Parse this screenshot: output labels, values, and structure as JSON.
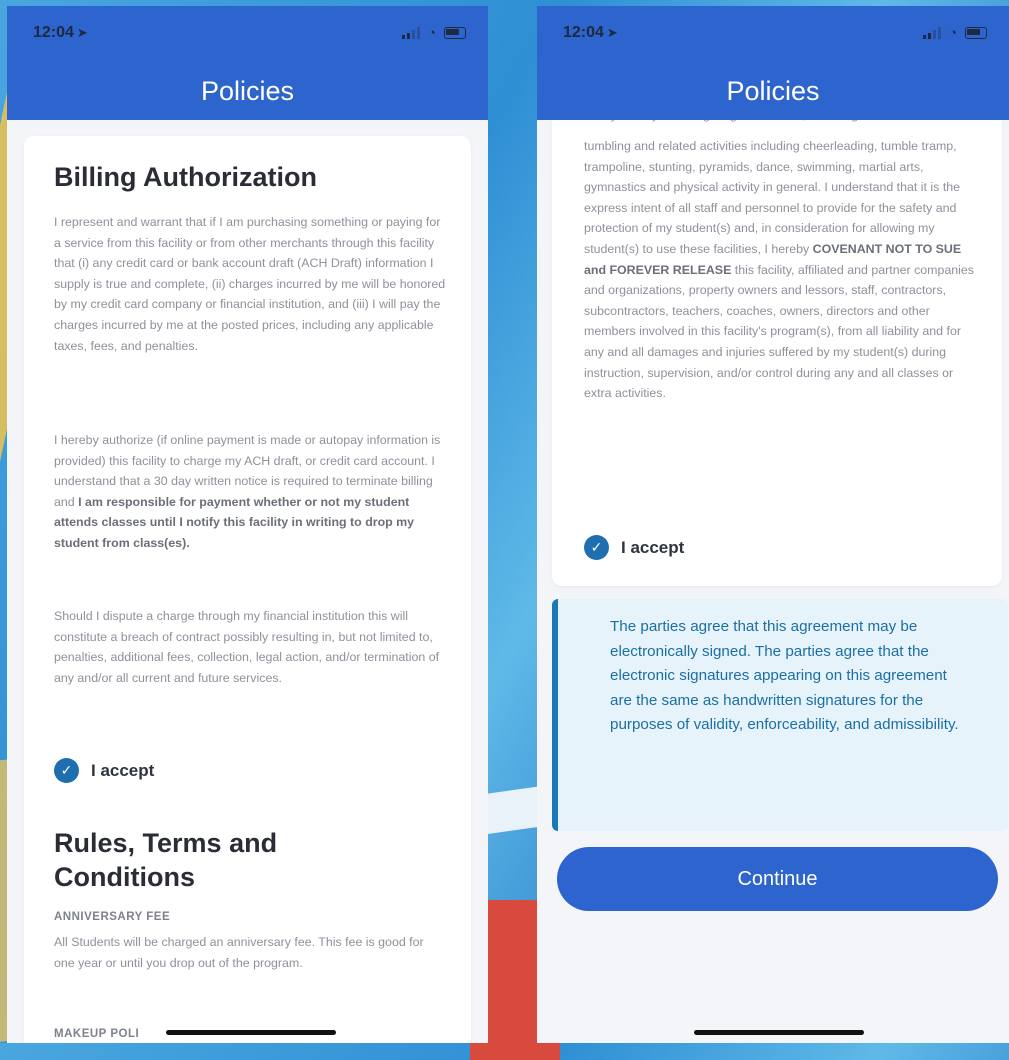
{
  "status": {
    "time": "12:04"
  },
  "nav": {
    "title": "Policies"
  },
  "left": {
    "billing": {
      "heading": "Billing Authorization",
      "p1": "I represent and warrant that if I am purchasing something or paying for a service from this facility or from other merchants through this facility that (i) any credit card or bank account draft (ACH Draft) information I supply is true and complete, (ii) charges incurred by me will be honored by my credit card company or financial institution, and (iii) I will pay the charges incurred by me at the posted prices, including any applicable taxes, fees, and penalties.",
      "p2_start": "I hereby authorize (if online payment is made or autopay information is provided) this facility to charge my ACH draft, or credit card account. I understand that a 30 day written notice is required to terminate billing and ",
      "p2_bold": "I am responsible for payment whether or not my student attends classes until I notify this facility in writing to drop my student from class(es).",
      "p3": "Should I dispute a charge through my financial institution this will constitute a breach of contract possibly resulting in, but not limited to, penalties, additional fees, collection, legal action, and/or termination of any and/or all current and future services.",
      "accept_label": "I accept"
    },
    "rules": {
      "heading": "Rules, Terms and Conditions",
      "fee_heading": "ANNIVERSARY FEE",
      "fee_text": "All Students will be charged an anniversary fee. This fee is good for one year or until you drop out of the program.",
      "makeup_heading": "MAKEUP POLI"
    }
  },
  "right": {
    "policy_cut": "in any activity involving height or motion, including",
    "policy_p1": "tumbling and related activities including cheerleading, tumble tramp, trampoline, stunting, pyramids, dance, swimming, martial arts, gymnastics and physical activity in general. I understand that it is the express intent of all staff and personnel to provide for the safety and protection of my student(s) and, in consideration for allowing my student(s) to use these facilities, I hereby ",
    "policy_bold": "COVENANT NOT TO SUE and FOREVER RELEASE",
    "policy_p2": " this facility, affiliated and partner companies and organizations, property owners and lessors, staff, contractors, subcontractors, teachers, coaches, owners, directors and other members involved in this facility's program(s), from all liability and for any and all damages and injuries suffered by my student(s) during instruction, supervision, and/or control during any and all classes or extra activities.",
    "accept_label": "I accept",
    "notice": "The parties agree that this agreement may be electronically signed. The parties agree that the electronic signatures appearing on this agreement are the same as handwritten signatures for the purposes of validity, enforceability, and admissibility.",
    "continue_label": "Continue"
  },
  "icons": {
    "check": "check-icon",
    "location": "location-arrow-icon",
    "wifi": "wifi-icon",
    "battery": "battery-icon",
    "signal": "signal-icon"
  },
  "colors": {
    "nav": "#2e64cd",
    "check": "#1f6fb0",
    "notice_bg": "#e6f3fa",
    "notice_text": "#1c6fa5"
  }
}
